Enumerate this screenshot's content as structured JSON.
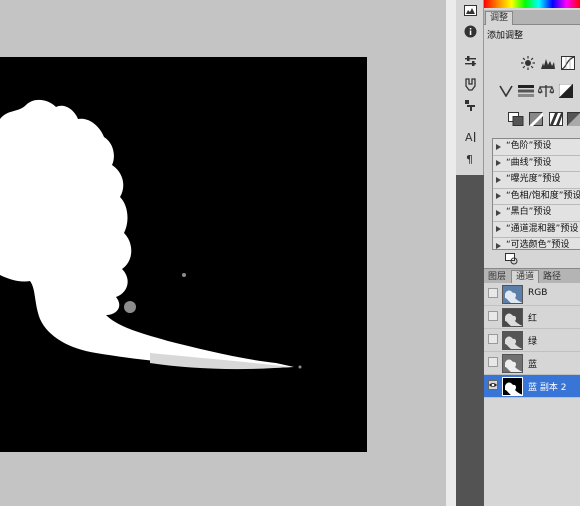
{
  "adjustments": {
    "tab_label": "调整",
    "title": "添加调整",
    "presets": [
      "“色阶”预设",
      "“曲线”预设",
      "“曝光度”预设",
      "“色相/饱和度”预设",
      "“黑白”预设",
      "“通道混和器”预设",
      "“可选颜色”预设"
    ]
  },
  "layers_panel": {
    "tabs": [
      "图层",
      "通道",
      "路径"
    ],
    "active_tab": "通道"
  },
  "channels": [
    {
      "name": "RGB",
      "visible": false,
      "selected": false
    },
    {
      "name": "红",
      "visible": false,
      "selected": false
    },
    {
      "name": "绿",
      "visible": false,
      "selected": false
    },
    {
      "name": "蓝",
      "visible": false,
      "selected": false
    },
    {
      "name": "蓝 副本 2",
      "visible": true,
      "selected": true
    }
  ],
  "colors": {
    "canvas_background": "#c4c4c4",
    "document_background": "#000000",
    "selection": "#3875d7",
    "panel": "#d6d6d6",
    "dark_toolbar": "#535353"
  },
  "icons": [
    "histogram-icon",
    "info-icon",
    "adjust-sliders-icon",
    "brush-tool-icon",
    "clone-source-icon",
    "character-icon",
    "paragraph-icon"
  ]
}
